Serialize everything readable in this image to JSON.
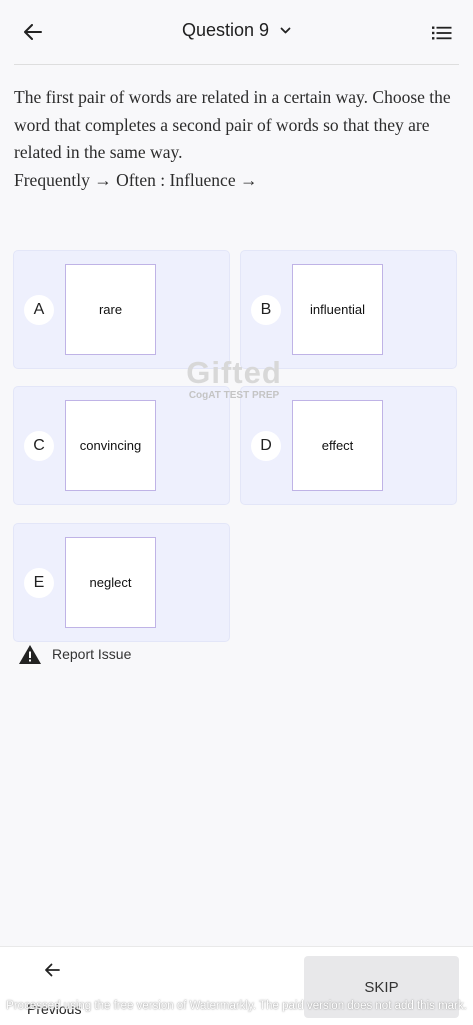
{
  "header": {
    "title": "Question 9",
    "back_icon": "arrow-left-icon",
    "dropdown_icon": "chevron-down-icon",
    "menu_icon": "list-icon"
  },
  "question": {
    "text": "The first pair of words are related in a certain way. Choose the word that completes a second pair of words so that they are related in the same way.",
    "analogy": "Frequently → Often : Influence →"
  },
  "options": [
    {
      "letter": "A",
      "word": "rare"
    },
    {
      "letter": "B",
      "word": "influential"
    },
    {
      "letter": "C",
      "word": "convincing"
    },
    {
      "letter": "D",
      "word": "effect"
    },
    {
      "letter": "E",
      "word": "neglect"
    }
  ],
  "watermark": {
    "logo": "Gifted",
    "subtitle": "CogAT TEST PREP"
  },
  "report": {
    "label": "Report Issue",
    "icon": "warning-icon"
  },
  "bottom": {
    "previous_label": "Previous",
    "skip_label": "SKIP"
  },
  "footnote": "Processed using the free version of Watermarkly. The paid version does not add this mark.",
  "colors": {
    "option_bg": "#eef0fd",
    "option_box_border": "#bfb3e6",
    "skip_bg": "#e8e8ea"
  }
}
